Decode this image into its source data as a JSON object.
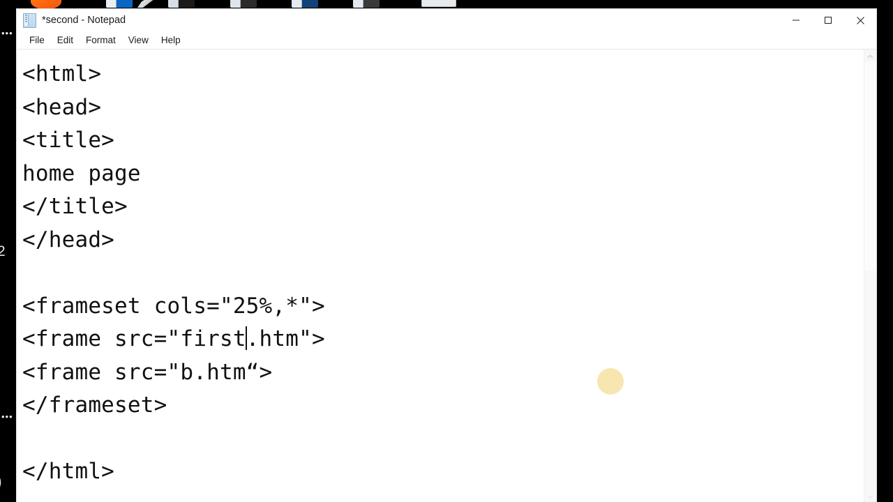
{
  "window": {
    "title": "*second - Notepad",
    "icon": "notepad-icon",
    "controls": {
      "minimize": "minimize-icon",
      "maximize": "maximize-icon",
      "close": "close-icon"
    }
  },
  "menubar": {
    "items": [
      {
        "label": "File"
      },
      {
        "label": "Edit"
      },
      {
        "label": "Format"
      },
      {
        "label": "View"
      },
      {
        "label": "Help"
      }
    ]
  },
  "editor": {
    "lines": [
      {
        "text": "<html>"
      },
      {
        "text": "<head>"
      },
      {
        "text": "<title>"
      },
      {
        "text": "home page"
      },
      {
        "text": "</title>"
      },
      {
        "text": "</head>"
      },
      {
        "text": ""
      },
      {
        "text": "<frameset cols=\"25%,*\">"
      },
      {
        "text": "<frame src=\"first",
        "caret": true,
        "text_after": ".htm\">"
      },
      {
        "text": "<frame src=\"b.htm“>"
      },
      {
        "text": "</frameset>"
      },
      {
        "text": ""
      },
      {
        "text": "</html>"
      }
    ],
    "caret_line_index": 8
  },
  "scrollbar": {
    "up_arrow": "chevron-up-icon",
    "down_arrow": "chevron-down-icon"
  },
  "overlay": {
    "click_indicator": "click-highlight-blob",
    "click_color": "#f7e6b0"
  },
  "gutter_fragments": [
    {
      "text": "•••"
    },
    {
      "text": "2"
    },
    {
      "text": "•••"
    },
    {
      "text": ")"
    }
  ],
  "colors": {
    "window_bg": "#ffffff",
    "desktop_bg": "#000000",
    "text": "#111111",
    "title_text": "#1b1b1b"
  }
}
